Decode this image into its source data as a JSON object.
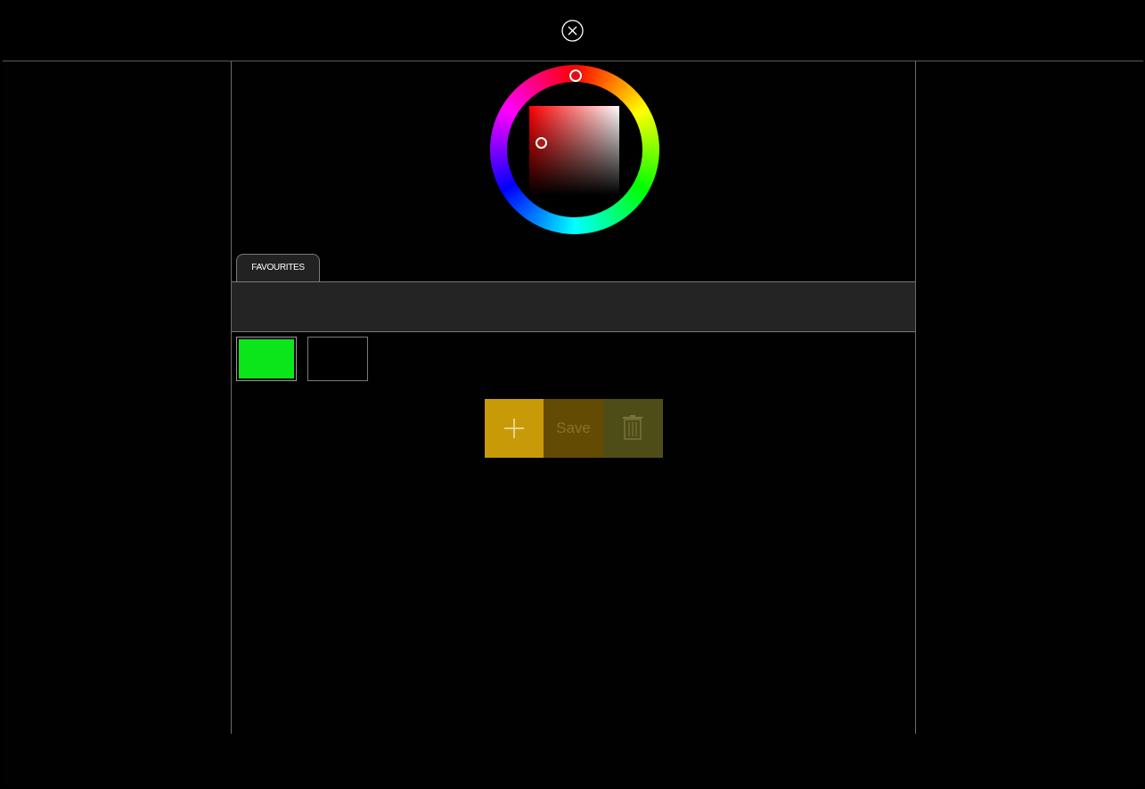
{
  "close": {
    "icon": "close-circle-icon"
  },
  "picker": {
    "hue_color": "#ff0000",
    "selected_color": "#b01818"
  },
  "favourites": {
    "tab_label": "FAVOURITES",
    "swatches": [
      {
        "color": "#0ae61a",
        "selected": true
      },
      {
        "color": "#000000",
        "selected": false
      }
    ]
  },
  "actions": {
    "add_icon": "plus-icon",
    "save_label": "Save",
    "delete_icon": "trash-icon",
    "add_color": "#c89a08",
    "save_color": "#644b04",
    "delete_color": "#4f4d17"
  }
}
